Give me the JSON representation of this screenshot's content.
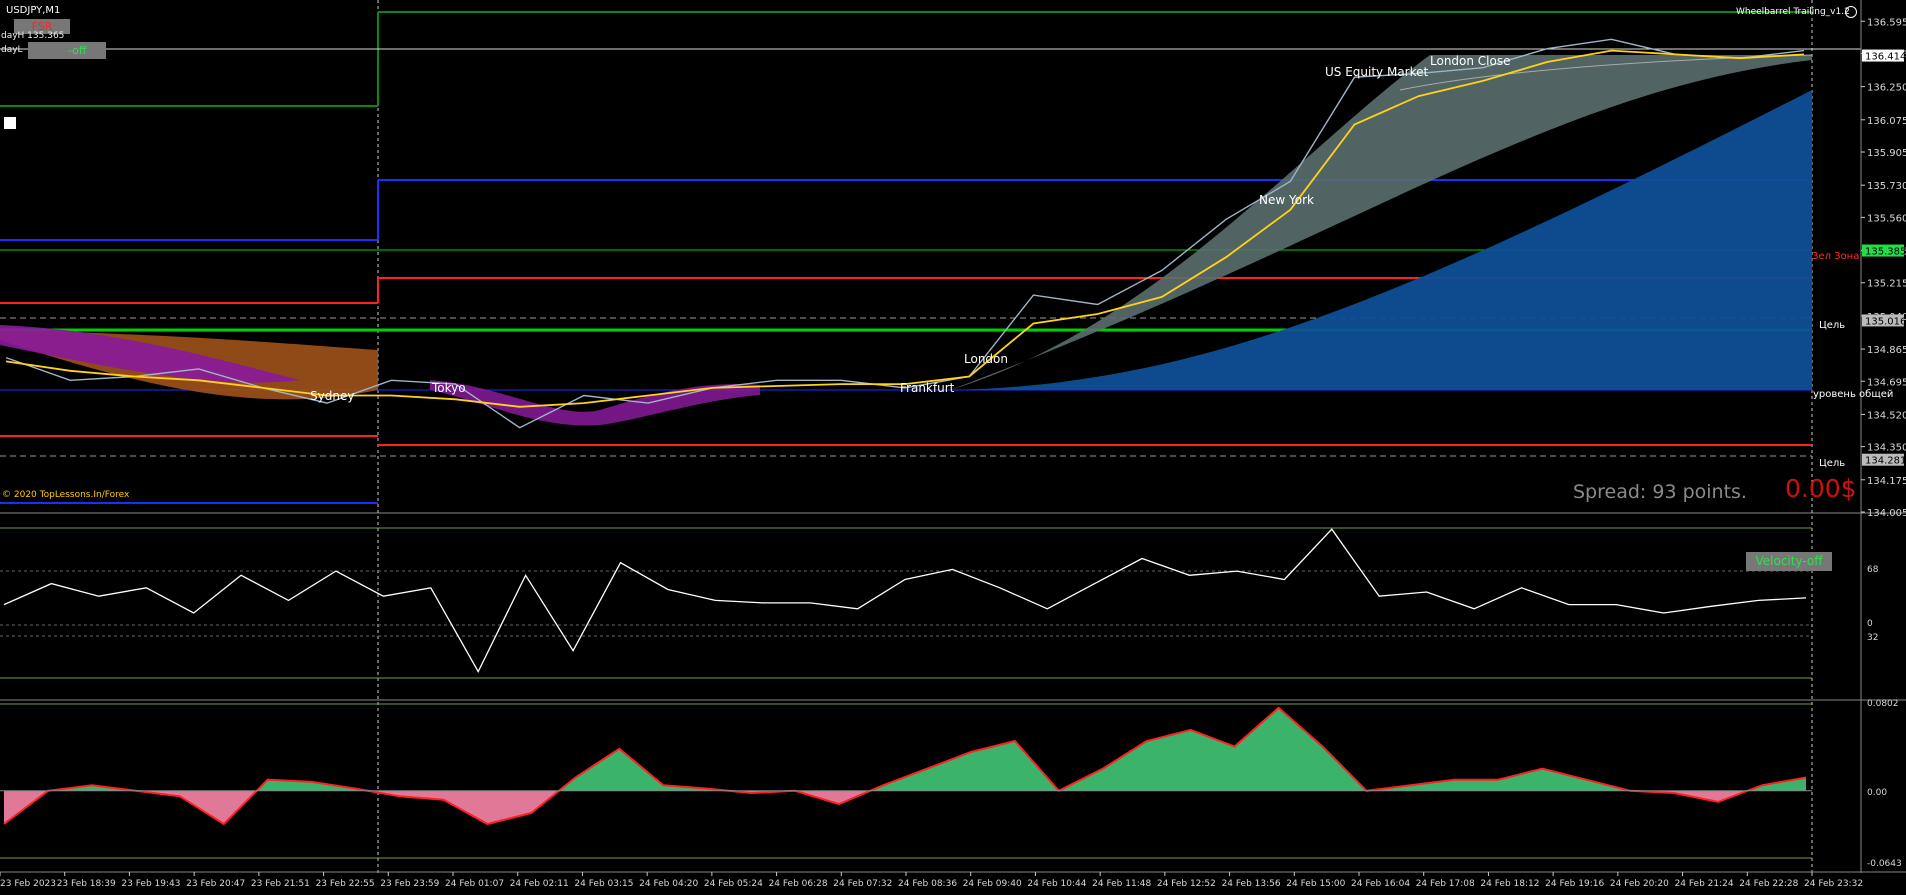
{
  "window": {
    "symbol_title": "USDJPY,M1",
    "indicator_title": "Wheelbarrel Trailing_v1.2",
    "copyright": "© 2020 TopLessons.In/Forex",
    "spread_text": "Spread: 93 points.",
    "profit_text": "0.00$",
    "day_high_text": "dayH 135.365",
    "day_low_prefix": "dayL",
    "fsr_label": "FSR",
    "panel_button_label": "-off",
    "velocity_button_label": "Velocity-off"
  },
  "sessions": [
    {
      "name": "Sydney"
    },
    {
      "name": "Tokyo"
    },
    {
      "name": "Frankfurt"
    },
    {
      "name": "London"
    },
    {
      "name": "New York"
    },
    {
      "name": "US Equity Market"
    },
    {
      "name": "London Close"
    }
  ],
  "levels": [
    {
      "text": "Зел Зона",
      "color": "#ff2a2a"
    },
    {
      "text": "Цель",
      "color": "#ffffff"
    },
    {
      "text": "уровень общей",
      "color": "#ffffff"
    },
    {
      "text": "Цель",
      "color": "#ffffff"
    }
  ],
  "colors": {
    "background": "#000000",
    "price_line": "#9fb4c8",
    "ma_yellow": "#ffd21a",
    "cloud_blue": "#0e4f96",
    "cloud_gray": "#5a6e6e",
    "cloud_orange": "#a0521a",
    "cloud_purple": "#8a1a9c",
    "hist_positive": "#3bb36a",
    "hist_negative": "#e07898",
    "line_red": "#ff2020",
    "accent_orange": "#ff9a1a",
    "accent_blue": "#3a9fff",
    "green_line": "#00d000",
    "axis_text": "#d8d8d8"
  },
  "chart_data": [
    {
      "type": "line",
      "title": "USDJPY,M1",
      "y_ticks": [
        "136.595",
        "136.425",
        "136.250",
        "136.075",
        "135.905",
        "135.730",
        "135.560",
        "135.385",
        "135.215",
        "135.040",
        "134.865",
        "134.695",
        "134.520",
        "134.350",
        "134.175",
        "134.005"
      ],
      "price_labels": [
        {
          "value": 136.414,
          "text": "136.414",
          "bg": "#ffffff",
          "fg": "#000000"
        },
        {
          "value": 135.385,
          "text": "135.385",
          "bg": "#22dd44",
          "fg": "#000000"
        },
        {
          "value": 135.016,
          "text": "135.016",
          "bg": "#bbbbbb",
          "fg": "#000000"
        },
        {
          "value": 134.281,
          "text": "134.281",
          "bg": "#bbbbbb",
          "fg": "#000000"
        }
      ],
      "ylim": [
        134.005,
        136.665
      ],
      "x": [
        "23 Feb 2023",
        "23 Feb 18:39",
        "23 Feb 19:43",
        "23 Feb 20:47",
        "23 Feb 21:51",
        "23 Feb 22:55",
        "23 Feb 23:59",
        "24 Feb 01:07",
        "24 Feb 02:11",
        "24 Feb 03:15",
        "24 Feb 04:20",
        "24 Feb 05:24",
        "24 Feb 06:28",
        "24 Feb 07:32",
        "24 Feb 08:36",
        "24 Feb 09:40",
        "24 Feb 10:44",
        "24 Feb 11:48",
        "24 Feb 12:52",
        "24 Feb 13:56",
        "24 Feb 15:00",
        "24 Feb 16:04",
        "24 Feb 17:08",
        "24 Feb 18:12",
        "24 Feb 19:16",
        "24 Feb 20:20",
        "24 Feb 21:24",
        "24 Feb 22:28",
        "24 Feb 23:32"
      ],
      "series": [
        {
          "values": [
            134.82,
            134.7,
            134.72,
            134.76,
            134.66,
            134.58,
            134.7,
            134.68,
            134.45,
            134.62,
            134.58,
            134.66,
            134.7,
            134.7,
            134.66,
            134.72,
            135.15,
            135.1,
            135.28,
            135.55,
            135.75,
            136.3,
            136.32,
            136.35,
            136.45,
            136.5,
            136.42,
            136.4,
            136.44
          ]
        },
        {
          "values": [
            134.8,
            134.75,
            134.72,
            134.7,
            134.66,
            134.62,
            134.62,
            134.6,
            134.56,
            134.58,
            134.62,
            134.66,
            134.67,
            134.68,
            134.68,
            134.72,
            135.0,
            135.05,
            135.14,
            135.35,
            135.6,
            136.05,
            136.2,
            136.28,
            136.38,
            136.44,
            136.42,
            136.4,
            136.42
          ]
        }
      ]
    },
    {
      "type": "line",
      "title": "Velocity",
      "y_ticks": [
        "68",
        "32",
        "0"
      ],
      "values": [
        20,
        45,
        30,
        40,
        10,
        55,
        25,
        60,
        30,
        40,
        -60,
        55,
        -35,
        70,
        38,
        25,
        22,
        22,
        15,
        50,
        62,
        40,
        15,
        45,
        75,
        55,
        60,
        50,
        110,
        30,
        35,
        15,
        40,
        20,
        20,
        10,
        18,
        25,
        28
      ]
    },
    {
      "type": "area",
      "title": "Oscillator",
      "y_ticks": [
        "0.0802",
        "0.00",
        "-0.0643"
      ],
      "ylim": [
        -0.0643,
        0.0802
      ],
      "values": [
        -0.03,
        0.0,
        0.005,
        0.0,
        -0.005,
        -0.03,
        0.01,
        0.008,
        0.002,
        -0.005,
        -0.008,
        -0.03,
        -0.02,
        0.012,
        0.038,
        0.005,
        0.002,
        -0.002,
        0.0,
        -0.012,
        0.005,
        0.02,
        0.035,
        0.045,
        0.0,
        0.02,
        0.045,
        0.055,
        0.04,
        0.075,
        0.04,
        0.0,
        0.005,
        0.01,
        0.01,
        0.02,
        0.01,
        0.0,
        -0.002,
        -0.01,
        0.005,
        0.012
      ]
    }
  ]
}
